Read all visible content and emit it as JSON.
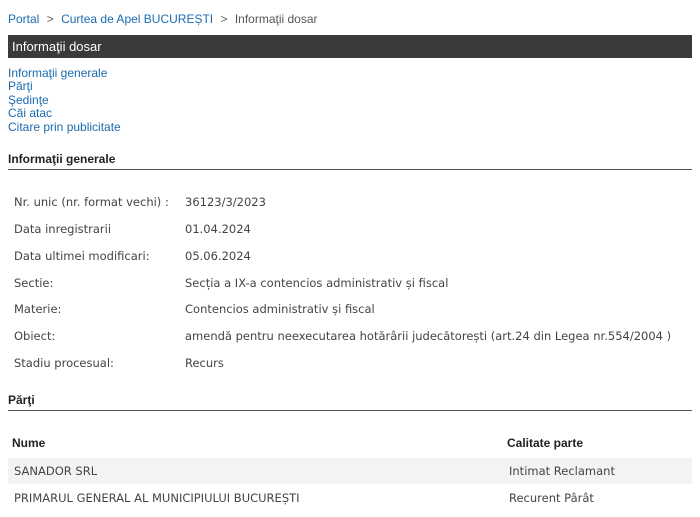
{
  "breadcrumb": {
    "items": [
      "Portal",
      "Curtea de Apel BUCUREȘTI",
      "Informaţii dosar"
    ],
    "separator": ">"
  },
  "title_bar": {
    "label": "Informaţii dosar"
  },
  "nav_links": [
    "Informaţii generale",
    "Părţi",
    "Şedinţe",
    "Căi atac",
    "Citare prin publicitate"
  ],
  "sections": {
    "general": "Informaţii generale",
    "parti": "Părţi"
  },
  "info": [
    {
      "label": "Nr. unic (nr. format vechi) :",
      "value": "36123/3/2023"
    },
    {
      "label": "Data inregistrarii",
      "value": "01.04.2024"
    },
    {
      "label": "Data ultimei modificari:",
      "value": "05.06.2024"
    },
    {
      "label": "Sectie:",
      "value": "Secția a IX-a contencios administrativ și fiscal"
    },
    {
      "label": "Materie:",
      "value": "Contencios administrativ și fiscal"
    },
    {
      "label": "Obiect:",
      "value": "amendă pentru neexecutarea hotărârii judecătorești (art.24 din Legea nr.554/2004 )"
    },
    {
      "label": "Stadiu procesual:",
      "value": "Recurs"
    }
  ],
  "parti_table": {
    "columns": [
      "Nume",
      "Calitate parte"
    ],
    "rows": [
      [
        "SANADOR SRL",
        "Intimat Reclamant"
      ],
      [
        "PRIMARUL GENERAL AL MUNICIPIULUI BUCUREȘTI",
        "Recurent Pârât"
      ]
    ]
  },
  "colors": {
    "link": "#1a6bb0",
    "title_bar_bg": "#3a3a3a",
    "row_alt_bg": "#f3f3f3"
  }
}
